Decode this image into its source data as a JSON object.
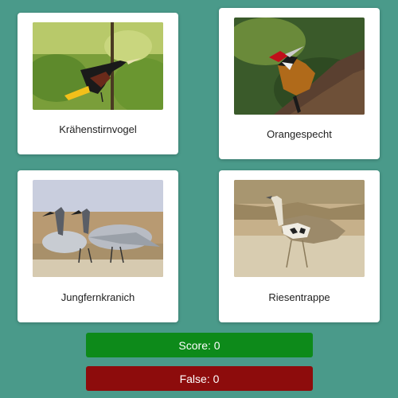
{
  "colors": {
    "background": "#4a9a8a",
    "card": "#ffffff",
    "score_bar": "#0d8a1a",
    "false_bar": "#8d0c0c"
  },
  "birds": [
    {
      "name": "Krähenstirnvogel",
      "image": "crested-oropendola-photo"
    },
    {
      "name": "Orangespecht",
      "image": "woodpecker-photo"
    },
    {
      "name": "Jungfernkranich",
      "image": "demoiselle-crane-photo"
    },
    {
      "name": "Riesentrappe",
      "image": "kori-bustard-photo"
    }
  ],
  "score": {
    "label": "Score: 0"
  },
  "false": {
    "label": "False: 0"
  }
}
